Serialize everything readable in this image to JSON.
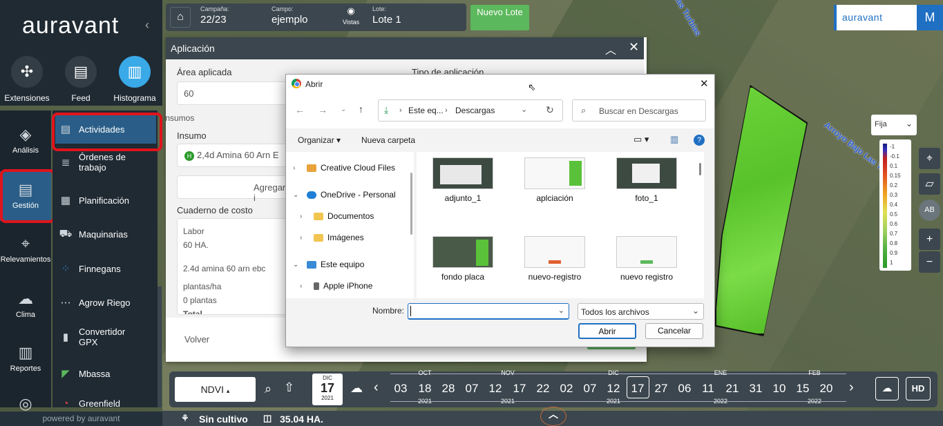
{
  "app": {
    "logo": "auravant",
    "powered": "powered by auravant"
  },
  "top_icons": [
    {
      "label": "Extensiones",
      "icon": "puzzle-icon"
    },
    {
      "label": "Feed",
      "icon": "feed-icon"
    },
    {
      "label": "Histograma",
      "icon": "histogram-icon"
    }
  ],
  "left_rail": [
    {
      "label": "Análisis",
      "glyph": "◈"
    },
    {
      "label": "Gestión",
      "glyph": "▤"
    },
    {
      "label": "Relevamientos",
      "glyph": "⌖"
    },
    {
      "label": "Clima",
      "glyph": "☁"
    },
    {
      "label": "Reportes",
      "glyph": "▥"
    }
  ],
  "menu": [
    {
      "label": "Actividades",
      "glyph": "▤"
    },
    {
      "label": "Órdenes de trabajo",
      "glyph": "≣"
    },
    {
      "label": "Planificación",
      "glyph": "▦"
    },
    {
      "label": "Maquinarias",
      "glyph": "⛟"
    },
    {
      "label": "Finnegans",
      "glyph": "⁘"
    },
    {
      "label": "Agrow Riego",
      "glyph": "⋯"
    },
    {
      "label": "Convertidor GPX",
      "glyph": "▮"
    },
    {
      "label": "Mbassa",
      "glyph": "◤"
    },
    {
      "label": "Greenfield",
      "glyph": "◔"
    }
  ],
  "topbar": {
    "campana_label": "Campaña:",
    "campana": "22/23",
    "campo_label": "Campo:",
    "campo": "ejemplo",
    "vistas": "Vistas",
    "lote_label": "Lote:",
    "lote": "Lote 1",
    "nuevo_lote": "Nuevo Lote"
  },
  "brand": {
    "name": "auravant",
    "user": "M"
  },
  "map": {
    "label1": "Arroyo Bajo Las Turbias",
    "label2": "Las Turbias"
  },
  "aplicacion": {
    "title": "Aplicación",
    "area_label": "Área aplicada",
    "area_value": "60",
    "tipo_label": "Tipo de aplicación",
    "insumos_label": "Insumos",
    "insumo_label": "Insumo",
    "insumo_value": "2,4d Amina 60 Arn E",
    "agregar": "Agregar i",
    "cuaderno_label": "Cuaderno de costo",
    "cuaderno": [
      "Labor",
      "60 HA.",
      "2.4d amina 60 arn ebc",
      "plantas/ha",
      "0 plantas",
      "Total"
    ],
    "volver": "Volver"
  },
  "dialog": {
    "title": "Abrir",
    "path": [
      "Este eq...",
      "Descargas"
    ],
    "search_placeholder": "Buscar en Descargas",
    "organizar": "Organizar",
    "nueva_carpeta": "Nueva carpeta",
    "tree": [
      {
        "label": "Creative Cloud Files",
        "color": "#e8a33a"
      },
      {
        "label": "OneDrive - Personal",
        "color": "#1f7fd6"
      },
      {
        "label": "Documentos",
        "color": "#f2c450"
      },
      {
        "label": "Imágenes",
        "color": "#f2c450"
      },
      {
        "label": "Este equipo",
        "color": "#3a8ad6"
      },
      {
        "label": "Apple iPhone",
        "color": "#666"
      }
    ],
    "files": [
      "adjunto_1",
      "aplciación",
      "foto_1",
      "fondo placa",
      "nuevo-registro",
      "nuevo registro"
    ],
    "nombre_label": "Nombre:",
    "filter": "Todos los archivos",
    "abrir": "Abrir",
    "cancelar": "Cancelar"
  },
  "timeline": {
    "index": "NDVI",
    "cal_month": "DIC",
    "cal_day": "17",
    "cal_year": "2021",
    "days": [
      "03",
      "18",
      "28",
      "07",
      "12",
      "17",
      "22",
      "02",
      "07",
      "12",
      "17",
      "27",
      "06",
      "11",
      "21",
      "31",
      "10",
      "15",
      "20"
    ],
    "months": [
      "OCT",
      "NOV",
      "DIC",
      "ENE",
      "FEB"
    ],
    "years": [
      "2021",
      "2021",
      "2021",
      "2022",
      "2022"
    ],
    "hd": "HD"
  },
  "legend": {
    "mode": "Fija",
    "values": [
      "-1",
      "-0.1",
      "0.1",
      "0.15",
      "0.2",
      "0.3",
      "0.4",
      "0.5",
      "0.6",
      "0.7",
      "0.8",
      "0.9",
      "1"
    ]
  },
  "footer": {
    "status": "Sin cultivo",
    "area": "35.04 HA."
  }
}
